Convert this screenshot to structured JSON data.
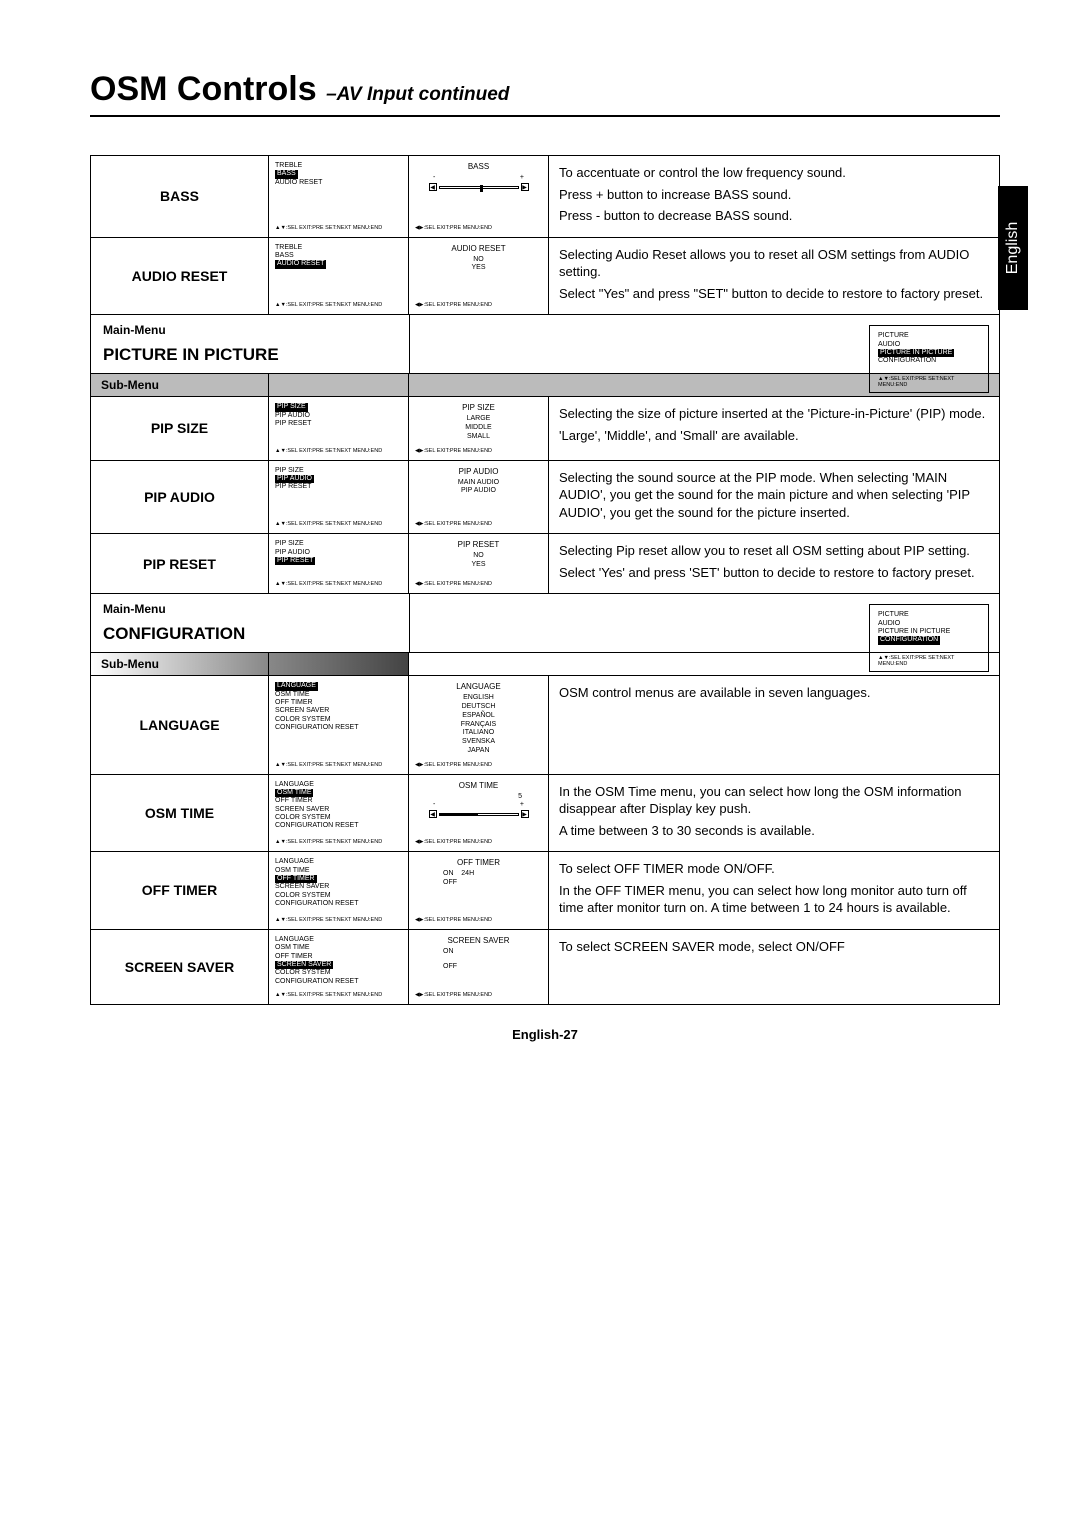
{
  "title": {
    "main": "OSM Controls ",
    "sub": "–AV Input continued"
  },
  "side_tab": "English",
  "labels": {
    "main_menu": "Main-Menu",
    "sub_menu": "Sub-Menu"
  },
  "symbols": {
    "plus": "+",
    "minus": "-"
  },
  "footers": {
    "sel_exit_preset_next_menu": ":SEL EXIT:PRE SET:NEXT MENU:END",
    "sel_exit_pre_menu": ":SEL   EXIT:PRE   MENU:END"
  },
  "main_menu": [
    "PICTURE",
    "AUDIO",
    "PICTURE IN PICTURE",
    "CONFIGURATION"
  ],
  "sections": {
    "pip": {
      "title": "PICTURE IN PICTURE"
    },
    "config": {
      "title": "CONFIGURATION"
    }
  },
  "rows": {
    "bass": {
      "name": "BASS",
      "menu": [
        "TREBLE",
        "BASS",
        "AUDIO RESET"
      ],
      "sub": {
        "title": "BASS"
      },
      "desc": [
        "To accentuate or control the low frequency sound.",
        "Press + button to increase BASS sound.",
        "Press - button to decrease BASS sound."
      ]
    },
    "audio_reset": {
      "name": "AUDIO RESET",
      "menu": [
        "TREBLE",
        "BASS",
        "AUDIO RESET"
      ],
      "sub": {
        "title": "AUDIO RESET",
        "opts": [
          "NO",
          "YES"
        ]
      },
      "desc": [
        "Selecting Audio Reset allows you to reset all OSM settings from AUDIO setting.",
        "Select \"Yes\" and press \"SET\" button to decide to restore to factory preset."
      ]
    },
    "pip_size": {
      "name": "PIP SIZE",
      "menu": [
        "PIP SIZE",
        "PIP AUDIO",
        "PIP RESET"
      ],
      "sub": {
        "title": "PIP SIZE",
        "opts": [
          "LARGE",
          "MIDDLE",
          "SMALL"
        ]
      },
      "desc": [
        "Selecting the size of picture inserted at the 'Picture-in-Picture' (PIP) mode.",
        "'Large', 'Middle', and 'Small' are available."
      ]
    },
    "pip_audio": {
      "name": "PIP AUDIO",
      "menu": [
        "PIP SIZE",
        "PIP AUDIO",
        "PIP RESET"
      ],
      "sub": {
        "title": "PIP AUDIO",
        "opts": [
          "MAIN AUDIO",
          "PIP AUDIO"
        ]
      },
      "desc": [
        "Selecting the sound source at the PIP mode. When selecting 'MAIN AUDIO', you get the sound for the main picture and when selecting 'PIP AUDIO', you get the sound for the picture inserted."
      ]
    },
    "pip_reset": {
      "name": "PIP RESET",
      "menu": [
        "PIP SIZE",
        "PIP AUDIO",
        "PIP RESET"
      ],
      "sub": {
        "title": "PIP RESET",
        "opts": [
          "NO",
          "YES"
        ]
      },
      "desc": [
        "Selecting Pip reset allow you to reset all OSM setting about PIP setting.",
        "Select 'Yes' and press 'SET' button to decide to restore to factory preset."
      ]
    },
    "language": {
      "name": "LANGUAGE",
      "menu": [
        "LANGUAGE",
        "OSM TIME",
        "OFF TIMER",
        "SCREEN SAVER",
        "COLOR SYSTEM",
        "CONFIGURATION RESET"
      ],
      "sub": {
        "title": "LANGUAGE",
        "opts": [
          "ENGLISH",
          "DEUTSCH",
          "ESPAÑOL",
          "FRANÇAIS",
          "ITALIANO",
          "SVENSKA",
          "JAPAN"
        ]
      },
      "desc": [
        "OSM control menus are available in seven languages."
      ]
    },
    "osm_time": {
      "name": "OSM TIME",
      "menu": [
        "LANGUAGE",
        "OSM TIME",
        "OFF TIMER",
        "SCREEN SAVER",
        "COLOR SYSTEM",
        "CONFIGURATION RESET"
      ],
      "sub": {
        "title": "OSM TIME",
        "value": "5"
      },
      "desc": [
        "In the OSM Time menu, you can select how long the OSM information disappear after Display key push.",
        "A time between 3 to 30 seconds is available."
      ]
    },
    "off_timer": {
      "name": "OFF TIMER",
      "menu": [
        "LANGUAGE",
        "OSM TIME",
        "OFF TIMER",
        "SCREEN SAVER",
        "COLOR SYSTEM",
        "CONFIGURATION RESET"
      ],
      "sub": {
        "title": "OFF TIMER",
        "opts": [
          "ON",
          "OFF"
        ],
        "extra": "24H"
      },
      "desc": [
        "To select OFF TIMER mode ON/OFF.",
        "In the OFF TIMER menu, you can select how long monitor auto turn off time after monitor turn on. A time between 1 to 24 hours is available."
      ]
    },
    "screen_saver": {
      "name": "SCREEN SAVER",
      "menu": [
        "LANGUAGE",
        "OSM TIME",
        "OFF TIMER",
        "SCREEN SAVER",
        "COLOR SYSTEM",
        "CONFIGURATION RESET"
      ],
      "sub": {
        "title": "SCREEN SAVER",
        "opts": [
          "ON",
          "OFF"
        ]
      },
      "desc": [
        "To select SCREEN SAVER mode, select ON/OFF"
      ]
    }
  },
  "footer": "English-27"
}
